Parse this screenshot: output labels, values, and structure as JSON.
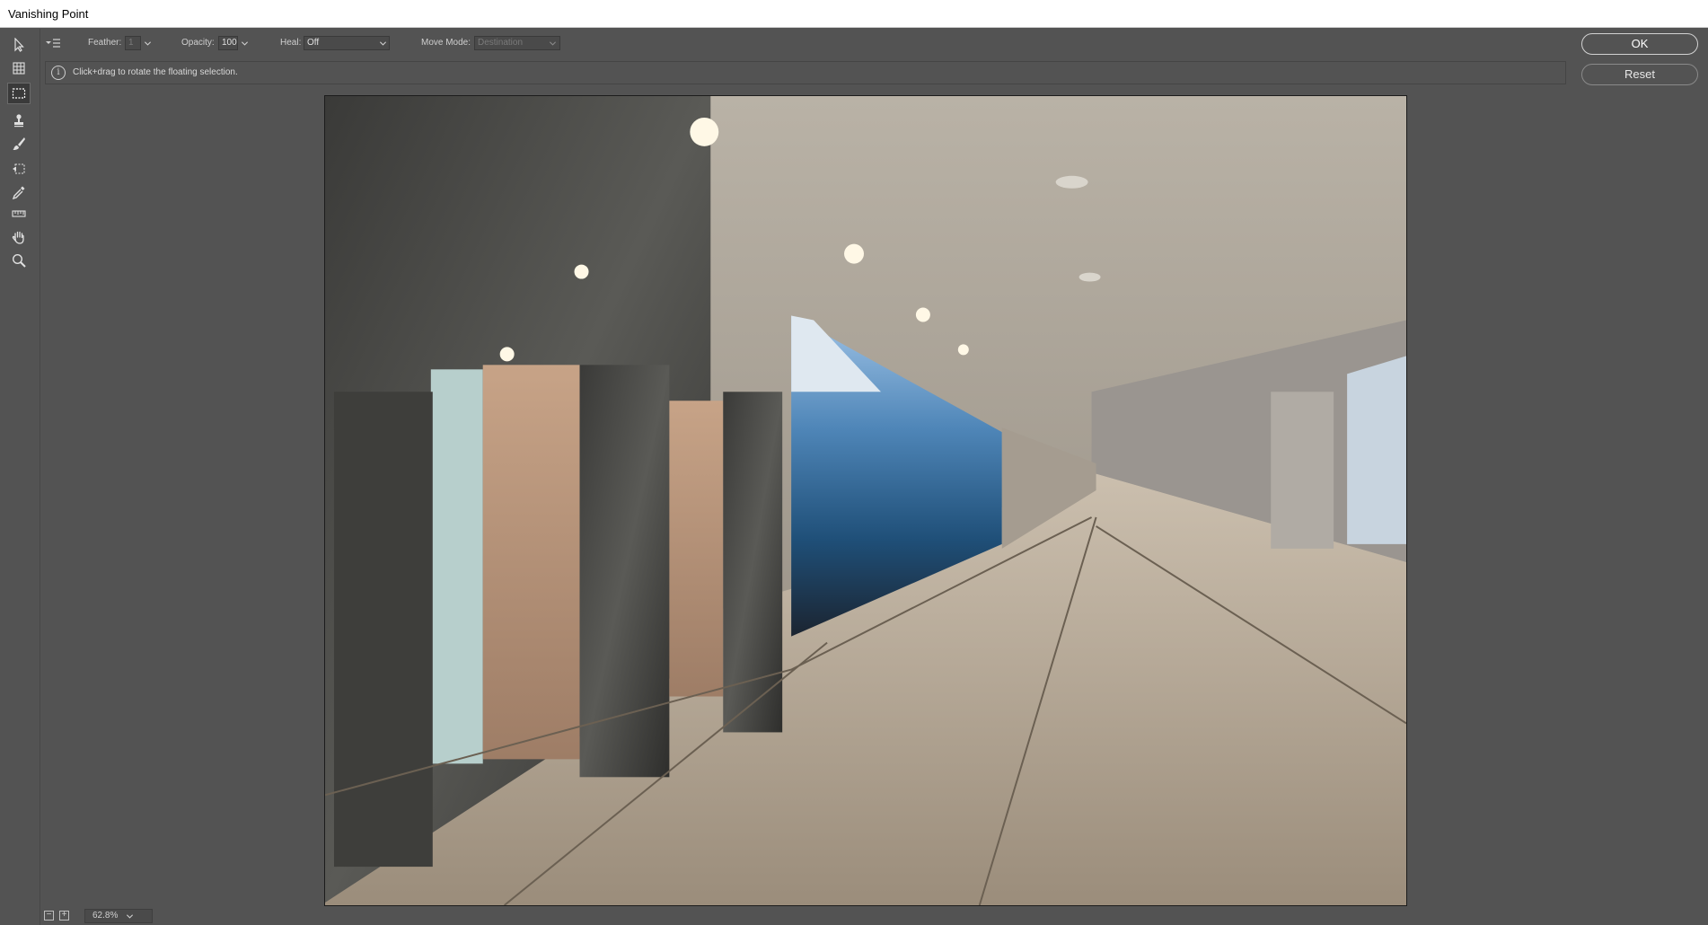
{
  "window": {
    "title": "Vanishing Point"
  },
  "toolbar": {
    "menu_icon": "flyout-menu-icon",
    "feather_label": "Feather:",
    "feather_value": "1",
    "opacity_label": "Opacity:",
    "opacity_value": "100",
    "heal_label": "Heal:",
    "heal_value": "Off",
    "move_mode_label": "Move Mode:",
    "move_mode_value": "Destination"
  },
  "info": {
    "message": "Click+drag to rotate the floating selection."
  },
  "buttons": {
    "ok": "OK",
    "reset": "Reset"
  },
  "tools": [
    {
      "name": "edit-plane-tool",
      "icon": "arrow-pointer-icon"
    },
    {
      "name": "create-plane-tool",
      "icon": "grid-plane-icon"
    },
    {
      "name": "marquee-tool",
      "icon": "marquee-icon",
      "active": true
    },
    {
      "name": "stamp-tool",
      "icon": "stamp-icon"
    },
    {
      "name": "brush-tool",
      "icon": "brush-icon"
    },
    {
      "name": "transform-tool",
      "icon": "transform-icon"
    },
    {
      "name": "eyedropper-tool",
      "icon": "eyedropper-icon"
    },
    {
      "name": "measure-tool",
      "icon": "ruler-icon"
    },
    {
      "name": "hand-tool",
      "icon": "hand-icon"
    },
    {
      "name": "zoom-tool",
      "icon": "magnifier-icon"
    }
  ],
  "status": {
    "zoom": "62.8%"
  },
  "colors": {
    "panel": "#535353",
    "titlebar": "#ffffff",
    "text": "#d6d6d6"
  }
}
